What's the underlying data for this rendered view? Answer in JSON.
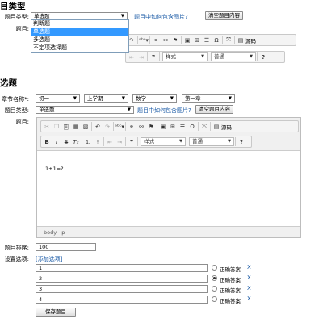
{
  "section1": {
    "title": "目类型",
    "type_label": "题目类型:",
    "type_value": "单选题",
    "how_link": "题目中如何包含图片?",
    "clear_button": "清空题目内容",
    "content_label": "题目:",
    "dropdown_options": [
      "判断题",
      "单选题",
      "多选题",
      "不定项选择题"
    ],
    "dropdown_selected": "单选题",
    "toolbar": {
      "source": "源码",
      "style": "样式",
      "format": "普通",
      "help": "?"
    }
  },
  "section2": {
    "title": "选题",
    "chapter_label": "章节名称*:",
    "chapter_selects": [
      "初一",
      "上学期",
      "数学",
      "第一章"
    ],
    "type_label": "题目类型:",
    "type_value": "单选题",
    "how_link": "题目中如何包含图片?",
    "clear_button": "清空题目内容",
    "content_label": "题目:",
    "toolbar": {
      "source": "源码",
      "style": "样式",
      "format": "普通",
      "help": "?"
    },
    "editor_text": "1+1=?",
    "status_path": [
      "body",
      "p"
    ],
    "order_label": "题目排序:",
    "order_value": "100",
    "options_label": "设置选项:",
    "add_option": "[添加选项]",
    "options": [
      {
        "value": "1",
        "answer_label": "正确答案",
        "checked": false
      },
      {
        "value": "2",
        "answer_label": "正确答案",
        "checked": true
      },
      {
        "value": "3",
        "answer_label": "正确答案",
        "checked": false
      },
      {
        "value": "4",
        "answer_label": "正确答案",
        "checked": false
      }
    ],
    "remove_icon": "X",
    "save_button": "保存题目"
  }
}
